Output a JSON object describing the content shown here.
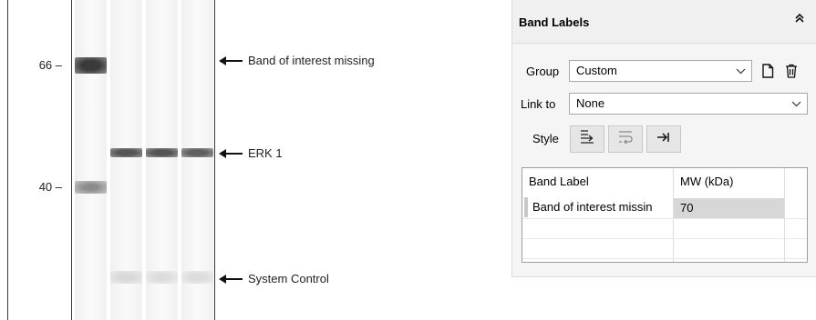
{
  "blot": {
    "mw_markers": [
      {
        "label": "66 –"
      },
      {
        "label": "40 –"
      }
    ],
    "annotations": [
      {
        "text": "Band of interest missing"
      },
      {
        "text": "ERK 1"
      },
      {
        "text": "System Control"
      }
    ]
  },
  "panel": {
    "title": "Band Labels",
    "collapse_icon": "double-chevron-up-icon",
    "group": {
      "label": "Group",
      "value": "Custom"
    },
    "link_to": {
      "label": "Link to",
      "value": "None"
    },
    "style": {
      "label": "Style",
      "buttons": [
        "arrow-style-icon",
        "wrap-style-icon",
        "tab-arrow-icon"
      ]
    },
    "table": {
      "columns": [
        "Band Label",
        "MW (kDa)"
      ],
      "rows": [
        {
          "band_label": "Band of interest missin",
          "mw": "70"
        }
      ]
    }
  }
}
